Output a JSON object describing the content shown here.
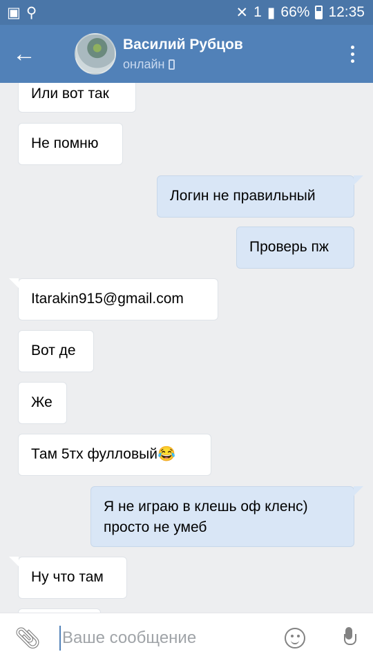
{
  "status_bar": {
    "battery": "66%",
    "time": "12:35",
    "sim": "1"
  },
  "header": {
    "back_icon": "arrow-left-icon",
    "name": "Василий Рубцов",
    "status": "онлайн",
    "menu_icon": "more-vertical-icon",
    "accent": "#5181b8"
  },
  "messages": [
    {
      "direction": "in",
      "text": "Или вот так"
    },
    {
      "direction": "in",
      "text": "Не помню"
    },
    {
      "direction": "out",
      "text": "Логин не правильный"
    },
    {
      "direction": "out",
      "text": "Проверь пж"
    },
    {
      "direction": "in",
      "text": "Itarakin915@gmail.com"
    },
    {
      "direction": "in",
      "text": "Вот де"
    },
    {
      "direction": "in",
      "text": "Же"
    },
    {
      "direction": "in",
      "text": "Там 5тх фулловый😂"
    },
    {
      "direction": "out",
      "text": "Я не играю в клешь оф кленс)\nпросто не умеб"
    },
    {
      "direction": "in",
      "text": "Ну что там"
    }
  ],
  "composer": {
    "placeholder": "Ваше сообщение",
    "attach_icon": "paperclip-icon",
    "emoji_icon": "emoji-icon",
    "mic_icon": "microphone-icon"
  }
}
